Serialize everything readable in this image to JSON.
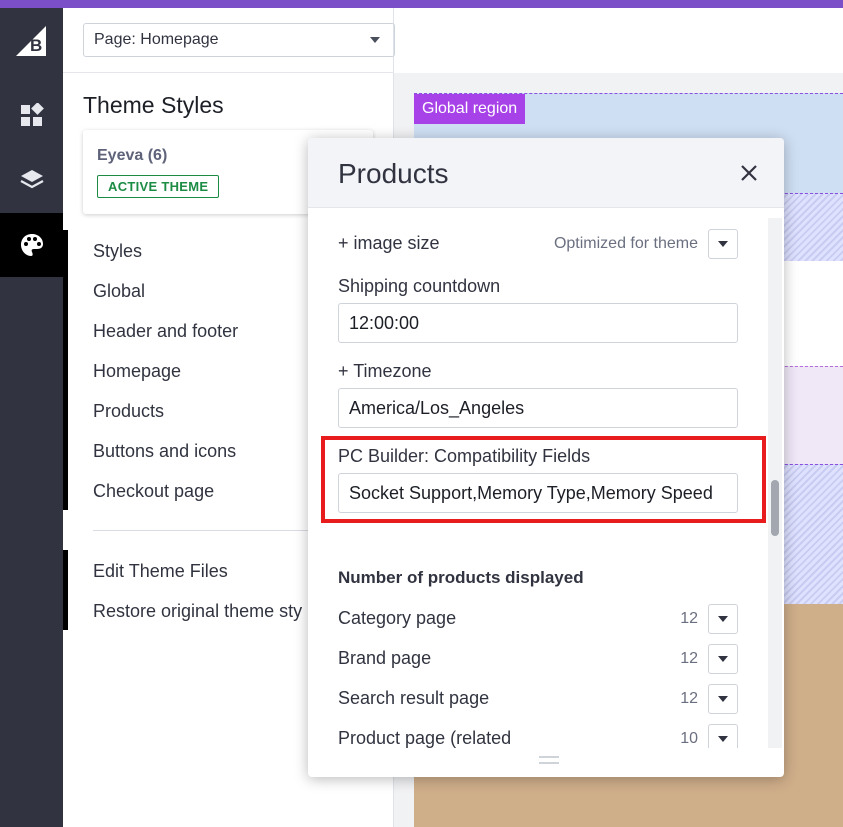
{
  "page_selector": {
    "value": "Page: Homepage"
  },
  "sidebar": {
    "title": "Theme Styles",
    "theme": {
      "name": "Eyeva (6)",
      "badge": "ACTIVE THEME"
    },
    "items": [
      "Styles",
      "Global",
      "Header and footer",
      "Homepage",
      "Products",
      "Buttons and icons",
      "Checkout page"
    ],
    "footer_items": [
      "Edit Theme Files",
      "Restore original theme sty"
    ]
  },
  "preview": {
    "region_label": "Global region"
  },
  "modal": {
    "title": "Products",
    "image_size": {
      "label": "+ image size",
      "value": "Optimized for theme"
    },
    "shipping": {
      "label": "Shipping countdown",
      "value": "12:00:00"
    },
    "timezone": {
      "label": "+ Timezone",
      "value": "America/Los_Angeles"
    },
    "pc_builder": {
      "label": "PC Builder: Compatibility Fields",
      "value": "Socket Support,Memory Type,Memory Speed"
    },
    "products_displayed": {
      "heading": "Number of products displayed",
      "rows": [
        {
          "label": "Category page",
          "value": "12"
        },
        {
          "label": "Brand page",
          "value": "12"
        },
        {
          "label": "Search result page",
          "value": "12"
        },
        {
          "label": "Product page (related",
          "value": "10"
        }
      ]
    }
  },
  "colors": {
    "accent": "#7b4fc7",
    "rail": "#313440",
    "highlight": "#e81c1c",
    "active_badge": "#1c8c45",
    "region_label": "#a741e8"
  }
}
